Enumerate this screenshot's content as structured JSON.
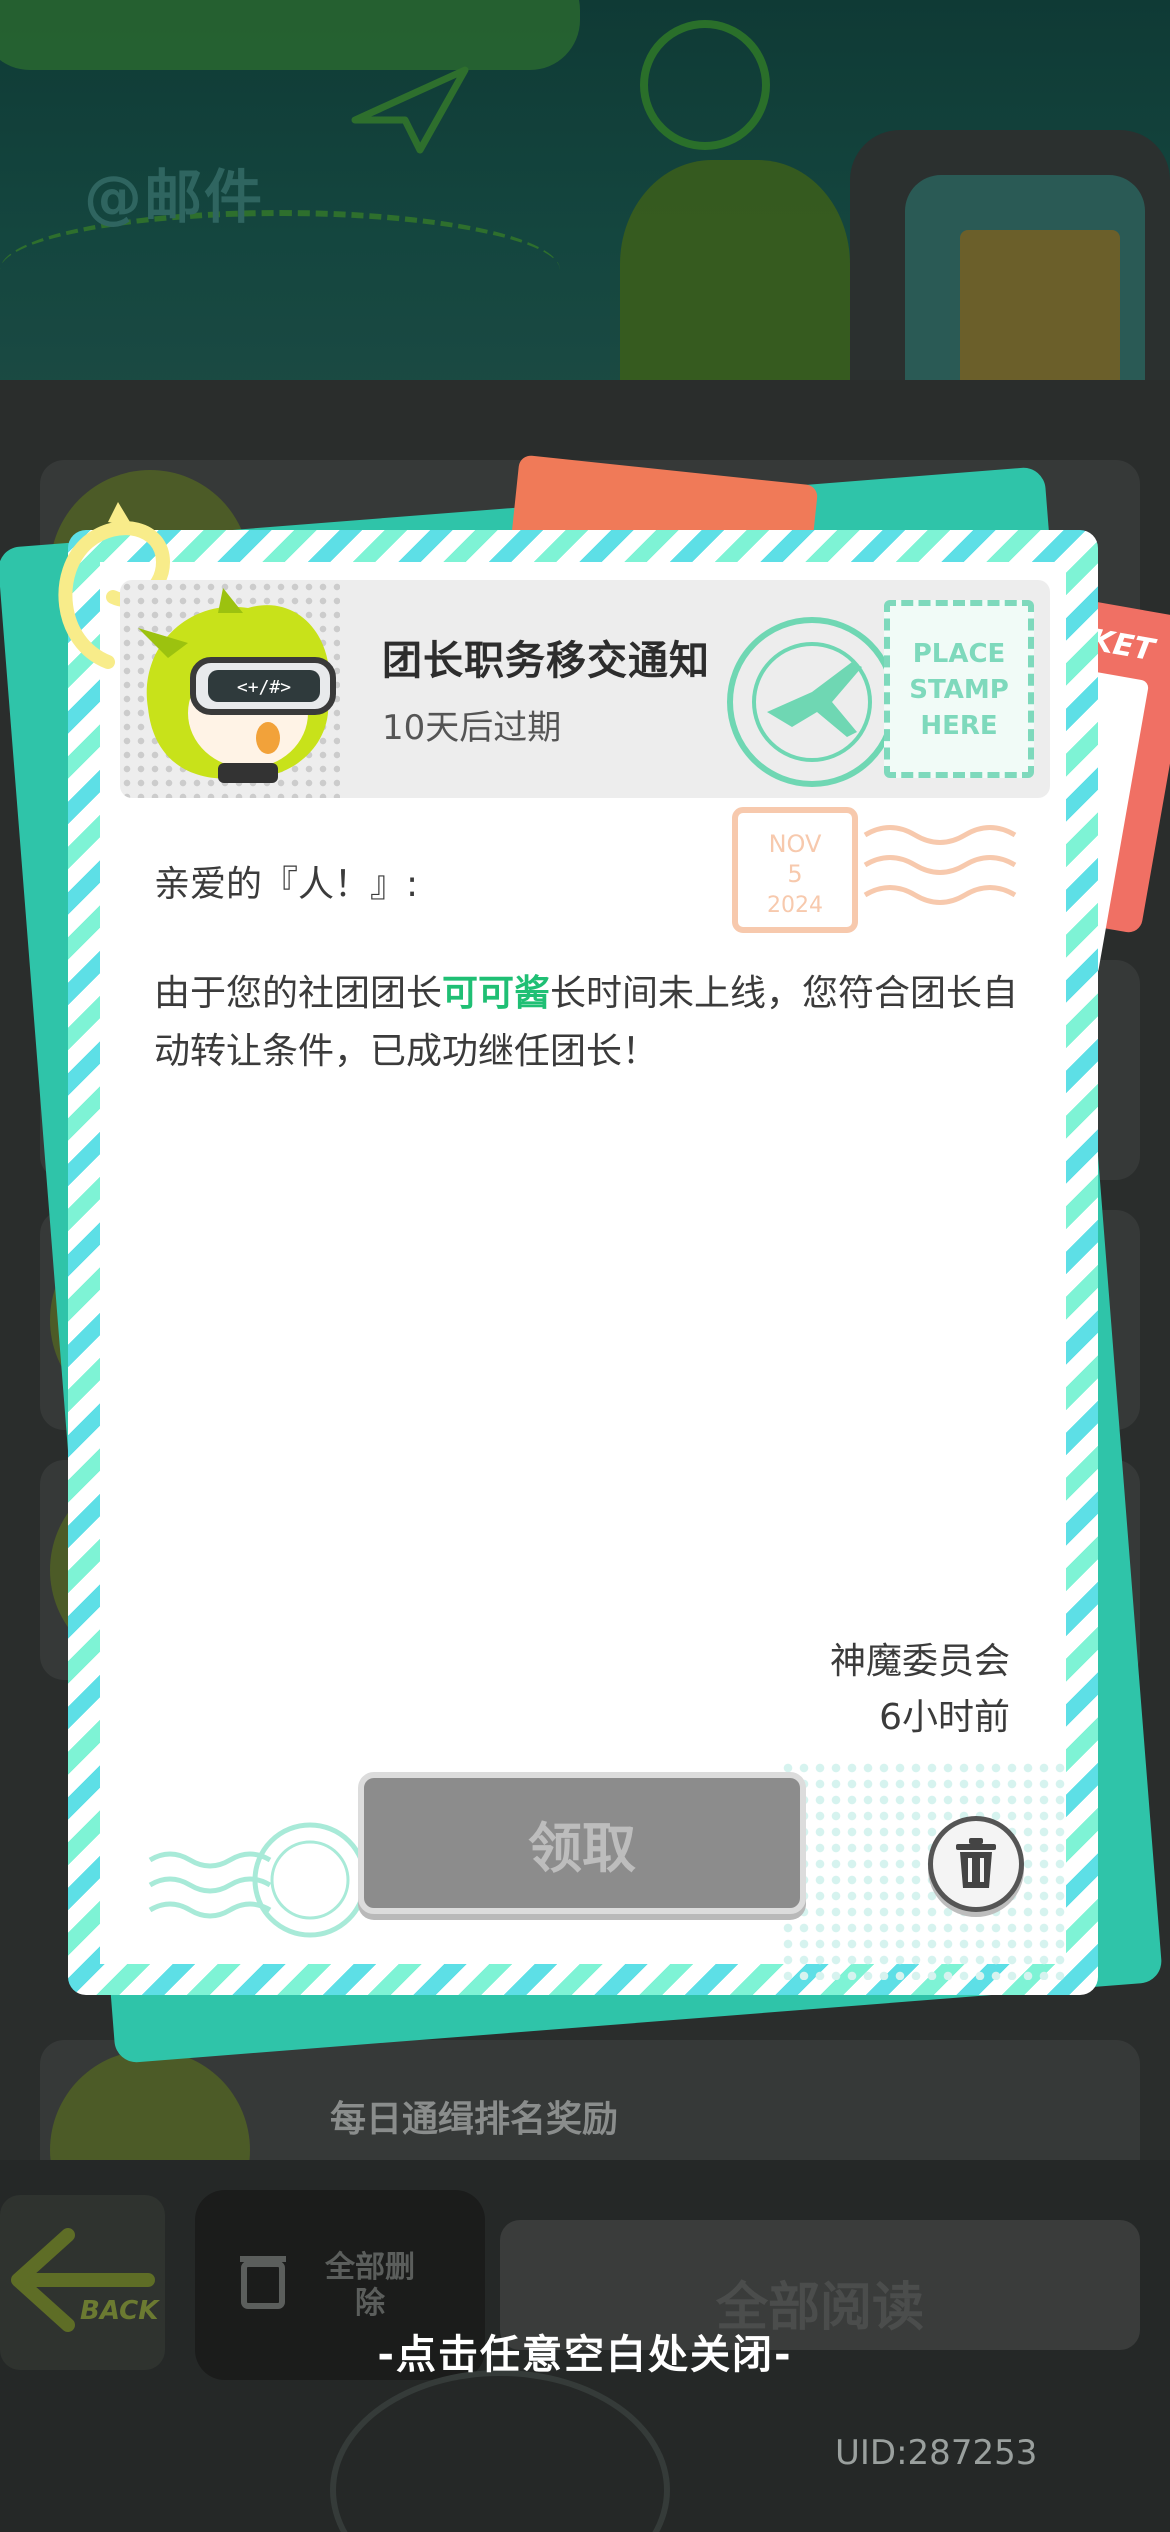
{
  "background": {
    "section_title": "@邮件",
    "list_items": [
      {
        "title": "每日通缉排名奖励"
      }
    ],
    "back_button_label": "BACK",
    "delete_all_label": "全部删除",
    "read_all_label": "全部阅读"
  },
  "letter": {
    "title": "团长职务移交通知",
    "expiry": "10天后过期",
    "greeting": "亲爱的『人！』:",
    "body_before": "由于您的社团团长",
    "body_highlight": "可可酱",
    "body_after": "长时间未上线，您符合团长自动转让条件，已成功继任团长！",
    "sender": "神魔委员会",
    "time": "6小时前",
    "claim_label": "领取",
    "stamp_text": "PLACE STAMP HERE",
    "postmark": {
      "month": "NOV",
      "day": "5",
      "year": "2024"
    }
  },
  "close_hint": "-点击任意空白处关闭-",
  "uid": "UID:287253",
  "colors": {
    "accent_green": "#1fbf74",
    "teal_card": "#2fc4a9",
    "stripe_blue": "#5ddfe6",
    "stripe_mint": "#7ef3d5",
    "claim_disabled": "#8c8c8c"
  },
  "icons": [
    "paper-clip-icon",
    "avatar-character",
    "airplane-stamp-icon",
    "trash-icon",
    "back-arrow-icon"
  ]
}
